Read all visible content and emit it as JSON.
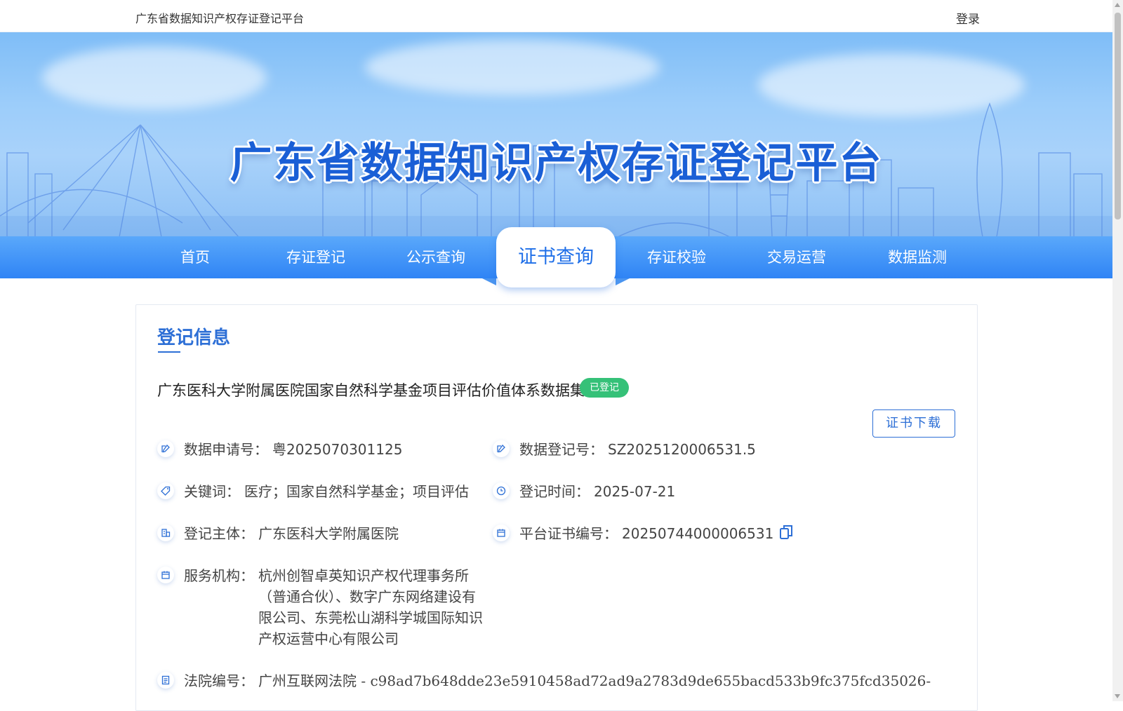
{
  "header": {
    "site_title": "广东省数据知识产权存证登记平台",
    "login_label": "登录"
  },
  "banner": {
    "title": "广东省数据知识产权存证登记平台"
  },
  "nav": {
    "items": [
      {
        "label": "首页"
      },
      {
        "label": "存证登记"
      },
      {
        "label": "公示查询"
      },
      {
        "label": "证书查询",
        "active": true
      },
      {
        "label": "存证校验"
      },
      {
        "label": "交易运营"
      },
      {
        "label": "数据监测"
      }
    ]
  },
  "record": {
    "section_title": "登记信息",
    "title": "广东医科大学附属医院国家自然科学基金项目评估价值体系数据集",
    "status": "已登记",
    "download_label": "证书下载",
    "fields": {
      "application_no": {
        "label": "数据申请号：",
        "value": "粤2025070301125",
        "icon": "edit-icon"
      },
      "registration_no": {
        "label": "数据登记号：",
        "value": "SZ2025120006531.5",
        "icon": "edit-icon"
      },
      "keywords": {
        "label": "关键词：",
        "value": "医疗；国家自然科学基金；项目评估",
        "icon": "tag-icon"
      },
      "registration_time": {
        "label": "登记时间：",
        "value": "2025-07-21",
        "icon": "clock-icon"
      },
      "registrant": {
        "label": "登记主体：",
        "value": "广东医科大学附属医院",
        "icon": "building-icon"
      },
      "certificate_no": {
        "label": "平台证书编号：",
        "value": "20250744000006531",
        "icon": "calendar-icon"
      },
      "service_org": {
        "label": "服务机构：",
        "value": "杭州创智卓英知识产权代理事务所（普通合伙）、数字广东网络建设有限公司、东莞松山湖科学城国际知识产权运营中心有限公司",
        "icon": "calendar-icon"
      },
      "court_no": {
        "label": "法院编号：",
        "value": "广州互联网法院 - c98ad7b648dde23e5910458ad72ad9a2783d9de655bacd533b9fc375fcd35026-",
        "icon": "document-icon"
      }
    }
  },
  "colors": {
    "accent": "#2d6fd6",
    "nav_gradient_top": "#5aa8fb",
    "nav_gradient_bottom": "#2f84f5",
    "status_green": "#35c178"
  }
}
